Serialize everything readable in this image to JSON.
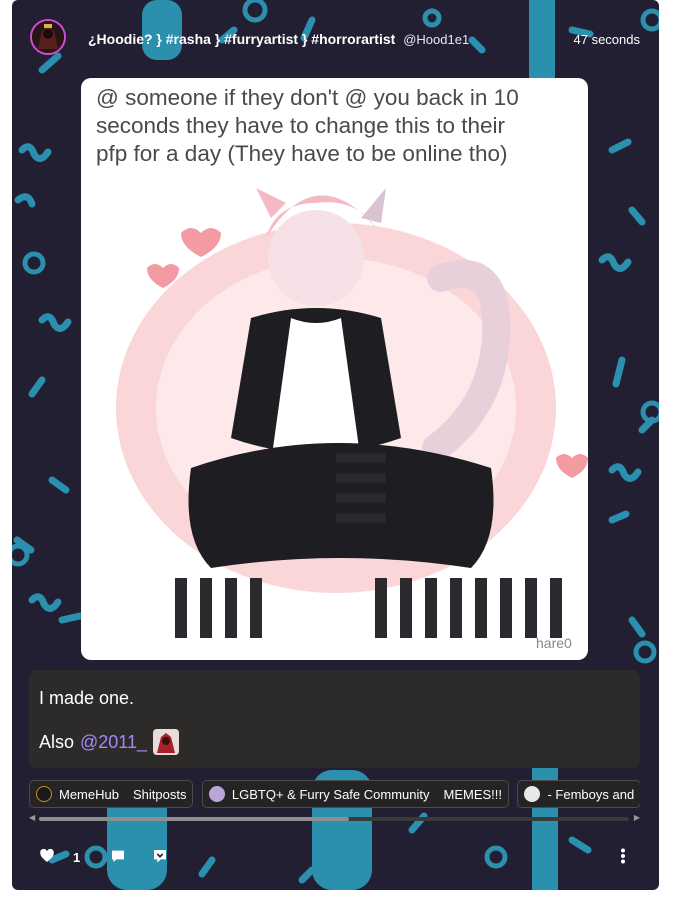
{
  "post": {
    "title": "¿Hoodie? } #rasha } #furryartist } #horrorartist",
    "handle": "@Hood1e1",
    "timestamp": "47 seconds",
    "image_text": [
      "@ someone if they don't @ you back in 10",
      "seconds they have to change this to their",
      "pfp for a day (They have to be online tho)"
    ],
    "image_watermark": "hare0",
    "caption_line1": "I made one.",
    "caption_also": "Also",
    "caption_mention": "@2011_"
  },
  "tags": [
    {
      "community": "MemeHub",
      "sub": "Shitposts",
      "icon_color": "#1a1a1a"
    },
    {
      "community": "LGBTQ+ & Furry Safe Community",
      "sub": "MEMES!!!",
      "icon_color": "#b9a6d8"
    },
    {
      "community": "- Femboys and",
      "sub": "",
      "icon_color": "#e8e8e8"
    }
  ],
  "actions": {
    "like_count": "1",
    "icons": [
      "heart-icon",
      "comment-icon",
      "repost-icon",
      "more-icon"
    ]
  },
  "colors": {
    "background": "#221f33",
    "pattern_teal": "#2b8fae",
    "mention": "#a787f5",
    "caption_bg": "#2c2b2a"
  }
}
